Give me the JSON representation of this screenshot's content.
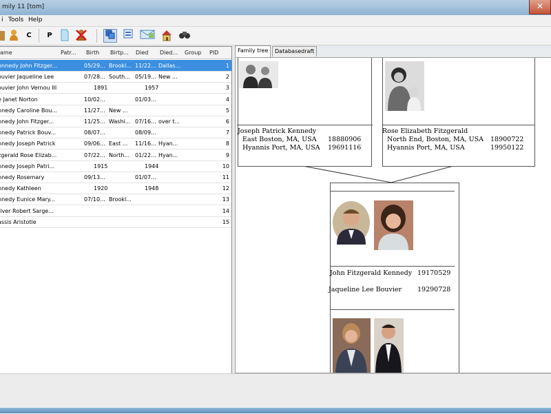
{
  "window": {
    "title": "mily 11 [tom]"
  },
  "menu": [
    {
      "label": "i"
    },
    {
      "label": "Tools"
    },
    {
      "label": "Help"
    }
  ],
  "toolbar": {
    "c_label": "C",
    "p_label": "P"
  },
  "grid": {
    "columns": [
      "ame",
      "Patr...",
      "Birth",
      "Birtp...",
      "Died",
      "Died...",
      "Group",
      "PID"
    ],
    "rows": [
      {
        "name": "ennedy John Fitzger...",
        "birth": "05/29...",
        "birthplace": "Brookl...",
        "died": "11/22...",
        "diedplace": "Dallas...",
        "pid": "1"
      },
      {
        "name": "ouvier Jaqueline Lee",
        "birth": "07/28...",
        "birthplace": "South...",
        "died": "05/19...",
        "diedplace": "New ...",
        "pid": "2"
      },
      {
        "name": "ouvier John Vernou III",
        "birth": "1891",
        "birthplace": "",
        "died": "1957",
        "diedplace": "",
        "pid": "3"
      },
      {
        "name": "e Janet Norton",
        "birth": "10/02...",
        "birthplace": "",
        "died": "01/03...",
        "diedplace": "",
        "pid": "4"
      },
      {
        "name": "nnedy Caroline Bou...",
        "birth": "11/27...",
        "birthplace": "New ...",
        "died": "",
        "diedplace": "",
        "pid": "5"
      },
      {
        "name": "nnedy John Fitzger...",
        "birth": "11/25...",
        "birthplace": "Washi...",
        "died": "07/16...",
        "diedplace": "over t...",
        "pid": "6"
      },
      {
        "name": "nnedy Patrick Bouv...",
        "birth": "08/07...",
        "birthplace": "",
        "died": "08/09...",
        "diedplace": "",
        "pid": "7"
      },
      {
        "name": "nnedy Joseph Patrick",
        "birth": "09/06...",
        "birthplace": "East ...",
        "died": "11/16...",
        "diedplace": "Hyan...",
        "pid": "8"
      },
      {
        "name": "zgerald Rose Elizab...",
        "birth": "07/22...",
        "birthplace": "North...",
        "died": "01/22...",
        "diedplace": "Hyan...",
        "pid": "9"
      },
      {
        "name": "nnedy Joseph Patri...",
        "birth": "1915",
        "birthplace": "",
        "died": "1944",
        "diedplace": "",
        "pid": "10"
      },
      {
        "name": "nnedy Rosemary",
        "birth": "09/13...",
        "birthplace": "",
        "died": "01/07...",
        "diedplace": "",
        "pid": "11"
      },
      {
        "name": "nnedy Kathleen",
        "birth": "1920",
        "birthplace": "",
        "died": "1948",
        "diedplace": "",
        "pid": "12"
      },
      {
        "name": "nnedy Eunice Mary...",
        "birth": "07/10...",
        "birthplace": "Brookl...",
        "died": "",
        "diedplace": "",
        "pid": "13"
      },
      {
        "name": "river Robert Sarge...",
        "birth": "",
        "birthplace": "",
        "died": "",
        "diedplace": "",
        "pid": "14"
      },
      {
        "name": "assis Aristotle",
        "birth": "",
        "birthplace": "",
        "died": "",
        "diedplace": "",
        "pid": "15"
      }
    ]
  },
  "tabs": [
    {
      "label": "Family tree"
    },
    {
      "label": "Databasedraft"
    }
  ],
  "tree": {
    "father": {
      "name": "Joseph Patrick Kennedy",
      "birthplace": "East Boston, MA, USA",
      "birth": "18880906",
      "deathplace": "Hyannis Port, MA, USA",
      "death": "19691116"
    },
    "mother": {
      "name": "Rose Elizabeth Fitzgerald",
      "birthplace": "North End, Boston, MA, USA",
      "birth": "18900722",
      "deathplace": "Hyannis Port, MA, USA",
      "death": "19950122"
    },
    "couple": {
      "person1_name": "John Fitzgerald Kennedy",
      "person1_birth": "19170529",
      "person2_name": "Jaqueline Lee Bouvier",
      "person2_birth": "19290728"
    }
  }
}
